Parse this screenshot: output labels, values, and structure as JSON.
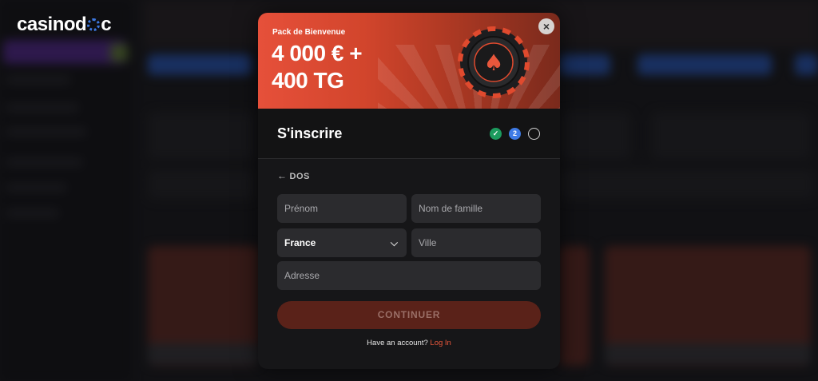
{
  "brand": {
    "logo_pre": "casinod",
    "logo_post": "c"
  },
  "modal": {
    "banner": {
      "subtitle": "Pack de Bienvenue",
      "amount_line1": "4 000 € +",
      "amount_line2": "400 TG"
    },
    "close_label": "×",
    "title": "S'inscrire",
    "steps": [
      {
        "state": "done",
        "label": "✓"
      },
      {
        "state": "active",
        "label": "2"
      },
      {
        "state": "todo",
        "label": ""
      }
    ],
    "back_label": "DOS",
    "form": {
      "first_name_placeholder": "Prénom",
      "last_name_placeholder": "Nom de famille",
      "country_value": "France",
      "city_placeholder": "Ville",
      "address_placeholder": "Adresse"
    },
    "continue_label": "CONTINUER",
    "account_prompt": "Have an account?",
    "login_label": "Log In"
  },
  "colors": {
    "accent": "#e8573c",
    "step_done": "#1c9b5e",
    "step_active": "#3e7be6",
    "continue_bg": "#5a2219"
  }
}
